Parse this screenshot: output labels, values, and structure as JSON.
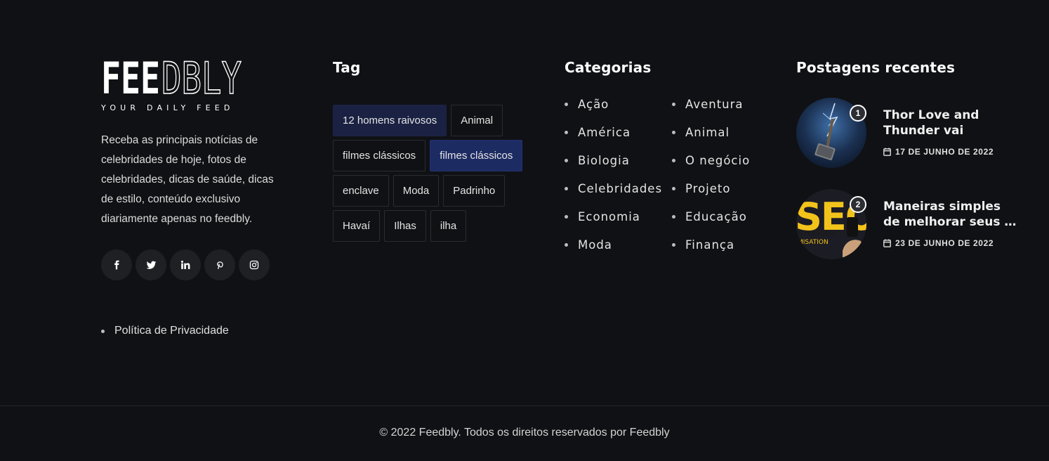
{
  "brand": {
    "logo_solid": "FEE",
    "logo_outline": "DBLY",
    "tagline": "YOUR DAILY FEED"
  },
  "about": {
    "text": "Receba as principais notícias de celebridades de hoje, fotos de celebridades, dicas de saúde, dicas de estilo, conteúdo exclusivo diariamente apenas no feedbly."
  },
  "social": [
    {
      "icon": "facebook-icon"
    },
    {
      "icon": "twitter-icon"
    },
    {
      "icon": "linkedin-icon"
    },
    {
      "icon": "pinterest-icon"
    },
    {
      "icon": "instagram-icon"
    }
  ],
  "links": {
    "privacy": "Política de Privacidade"
  },
  "tags": {
    "title": "Tag",
    "items": [
      {
        "label": "12 homens raivosos",
        "state": "active"
      },
      {
        "label": "Animal",
        "state": ""
      },
      {
        "label": "filmes clássicos",
        "state": ""
      },
      {
        "label": "filmes clássicos",
        "state": "active-strong"
      },
      {
        "label": "enclave",
        "state": ""
      },
      {
        "label": "Moda",
        "state": ""
      },
      {
        "label": "Padrinho",
        "state": ""
      },
      {
        "label": "Havaí",
        "state": ""
      },
      {
        "label": "Ilhas",
        "state": ""
      },
      {
        "label": "ilha",
        "state": ""
      }
    ]
  },
  "categories": {
    "title": "Categorias",
    "items": [
      "Ação",
      "Aventura",
      "América",
      "Animal",
      "Biologia",
      "O negócio",
      "Celebridades",
      "Projeto",
      "Economia",
      "Educação",
      "Moda",
      "Finança"
    ]
  },
  "recent": {
    "title": "Postagens recentes",
    "posts": [
      {
        "number": "1",
        "title": "Thor Love and Thunder vai muda…",
        "date": "17 DE JUNHO DE 2022"
      },
      {
        "number": "2",
        "title": "Maneiras simples de melhorar seus …",
        "date": "23 DE JUNHO DE 2022"
      }
    ]
  },
  "copyright": "© 2022 Feedbly. Todos os direitos reservados por Feedbly",
  "colors": {
    "background": "#101114",
    "tag_active": "#1a2142",
    "tag_active_strong": "#1d2b63"
  }
}
